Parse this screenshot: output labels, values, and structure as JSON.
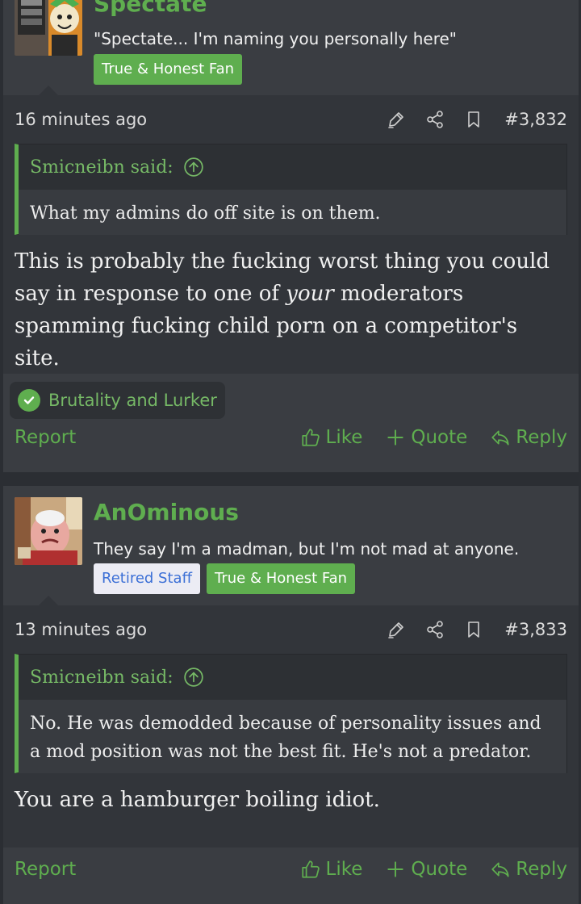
{
  "posts": [
    {
      "username": "Spectate",
      "user_title": "\"Spectate... I'm naming you personally here\"",
      "banners": [
        "True & Honest Fan"
      ],
      "time": "16 minutes ago",
      "post_number": "#3,832",
      "quote_author": "Smicneibn said:",
      "quote_text": "What my admins do off site is on them.",
      "message_before": "This is probably the fucking worst thing you could say in response to one of ",
      "message_emphasis": "your",
      "message_after": " moderators spamming fucking child porn on a competitor's site.",
      "reactions": "Brutality and Lurker"
    },
    {
      "username": "AnOminous",
      "user_title": "They say I'm a madman, but I'm not mad at anyone.",
      "banners": [
        "Retired Staff",
        "True & Honest Fan"
      ],
      "time": "13 minutes ago",
      "post_number": "#3,833",
      "quote_author": "Smicneibn said:",
      "quote_text": "No. He was demodded because of personality issues and a mod position was not the best fit. He's not a predator.",
      "message": "You are a hamburger boiling idiot."
    }
  ],
  "actions": {
    "report": "Report",
    "like": "Like",
    "quote": "Quote",
    "reply": "Reply"
  },
  "icons": [
    "edit-icon",
    "share-icon",
    "bookmark-icon",
    "arrow-up-circle-icon",
    "checkmark-icon",
    "thumbs-up-icon",
    "plus-icon",
    "reply-icon"
  ],
  "colors": {
    "accent": "#5fae4f",
    "staff_banner_bg": "#ececf4",
    "staff_banner_text": "#3b6fd6",
    "post_bg": "#32353a"
  }
}
